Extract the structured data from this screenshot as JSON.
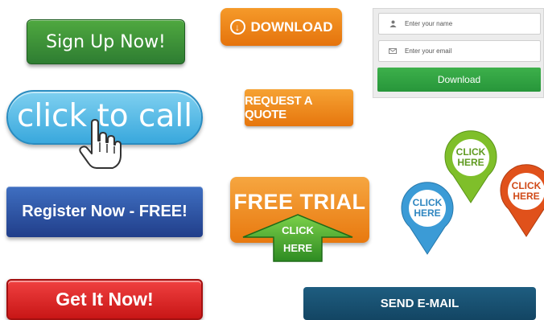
{
  "buttons": {
    "sign_up": "Sign Up Now!",
    "download": "DOWNLOAD",
    "click_to_call": "click to call",
    "request_quote": "REQUEST A QUOTE",
    "register": "Register Now - FREE!",
    "free_trial": "FREE TRIAL",
    "click_here_top": "CLICK",
    "click_here_bottom": "HERE",
    "get_it": "Get It Now!",
    "send_email": "SEND E-MAIL"
  },
  "form": {
    "name_placeholder": "Enter your name",
    "email_placeholder": "Enter your email",
    "submit": "Download"
  },
  "pins": [
    {
      "line1": "CLICK",
      "line2": "HERE",
      "color": "#7fbf2a"
    },
    {
      "line1": "CLICK",
      "line2": "HERE",
      "color": "#e0511b"
    },
    {
      "line1": "CLICK",
      "line2": "HERE",
      "color": "#3b9bd6"
    }
  ],
  "icons": {
    "download": "download-arrow-circle-icon",
    "name_field": "user-icon",
    "email_field": "envelope-icon",
    "pointer": "hand-pointer-icon"
  }
}
